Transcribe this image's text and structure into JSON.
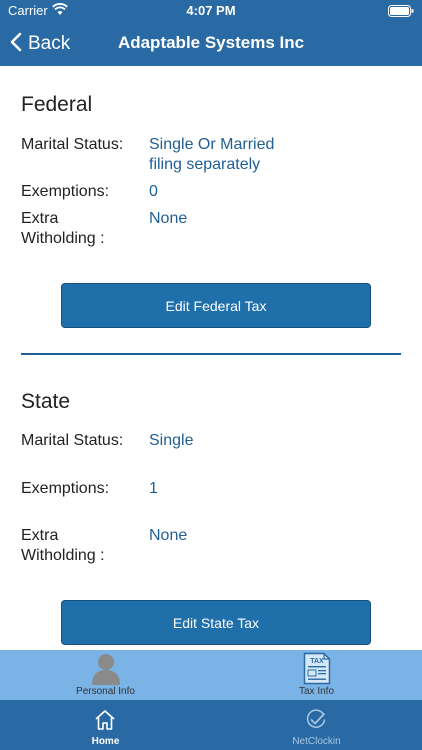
{
  "status_bar": {
    "carrier": "Carrier",
    "time": "4:07 PM"
  },
  "nav": {
    "back_label": "Back",
    "title": "Adaptable Systems Inc"
  },
  "federal": {
    "heading": "Federal",
    "marital_status_label": "Marital Status:",
    "marital_status_line1": "Single Or Married",
    "marital_status_line2": "filing separately",
    "exemptions_label": "Exemptions:",
    "exemptions_value": "0",
    "extra_label_line1": "Extra",
    "extra_label_line2": "Witholding :",
    "extra_value": "None",
    "edit_button": "Edit Federal Tax"
  },
  "state": {
    "heading": "State",
    "marital_status_label": "Marital Status:",
    "marital_status_value": "Single",
    "exemptions_label": "Exemptions:",
    "exemptions_value": "1",
    "extra_label_line1": "Extra",
    "extra_label_line2": "Witholding :",
    "extra_value": "None",
    "edit_button": "Edit State Tax"
  },
  "sub_tabs": [
    {
      "label": "Personal Info",
      "icon": "person-icon",
      "selected": false
    },
    {
      "label": "Tax Info",
      "icon": "tax-document-icon",
      "selected": true
    }
  ],
  "tab_bar": [
    {
      "label": "Home",
      "icon": "home-icon",
      "selected": true
    },
    {
      "label": "NetClockin",
      "icon": "check-clock-icon",
      "selected": false
    }
  ],
  "colors": {
    "nav_background": "#2a6aa4",
    "value_text": "#1f5f96",
    "button": "#1f6faa",
    "sub_tab_background": "#7ab3e6"
  }
}
